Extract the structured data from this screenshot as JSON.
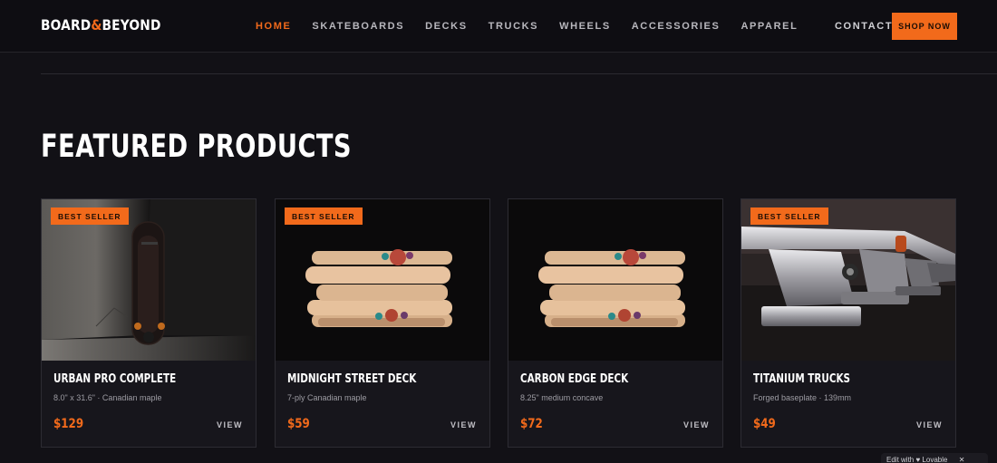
{
  "brand": {
    "logo_left": "BOARD",
    "logo_amp": "&",
    "logo_right": "BEYOND"
  },
  "nav": {
    "links": [
      "HOME",
      "SKATEBOARDS",
      "DECKS",
      "TRUCKS",
      "WHEELS",
      "ACCESSORIES",
      "APPAREL"
    ],
    "active": "HOME",
    "contact": "CONTACT",
    "cta": "SHOP NOW"
  },
  "section": {
    "title": "FEATURED PRODUCTS"
  },
  "products": [
    {
      "badge": "BEST SELLER",
      "name": "URBAN PRO COMPLETE",
      "spec": "8.0\" x 31.6\" · Canadian maple",
      "price": "$129",
      "action": "VIEW",
      "image": "skateboard-photo"
    },
    {
      "badge": "BEST SELLER",
      "name": "MIDNIGHT STREET DECK",
      "spec": "7-ply Canadian maple",
      "price": "$59",
      "action": "VIEW",
      "image": "deck-stack-photo"
    },
    {
      "badge": "",
      "name": "CARBON EDGE DECK",
      "spec": "8.25\" medium concave",
      "price": "$72",
      "action": "VIEW",
      "image": "deck-stack-photo"
    },
    {
      "badge": "BEST SELLER",
      "name": "TITANIUM TRUCKS",
      "spec": "Forged baseplate · 139mm",
      "price": "$49",
      "action": "VIEW",
      "image": "trucks-photo"
    }
  ],
  "widget": {
    "label": "Edit with ♥ Lovable",
    "close": "✕"
  },
  "colors": {
    "accent": "#f26a1b",
    "background": "#121116",
    "card": "#17161c"
  }
}
